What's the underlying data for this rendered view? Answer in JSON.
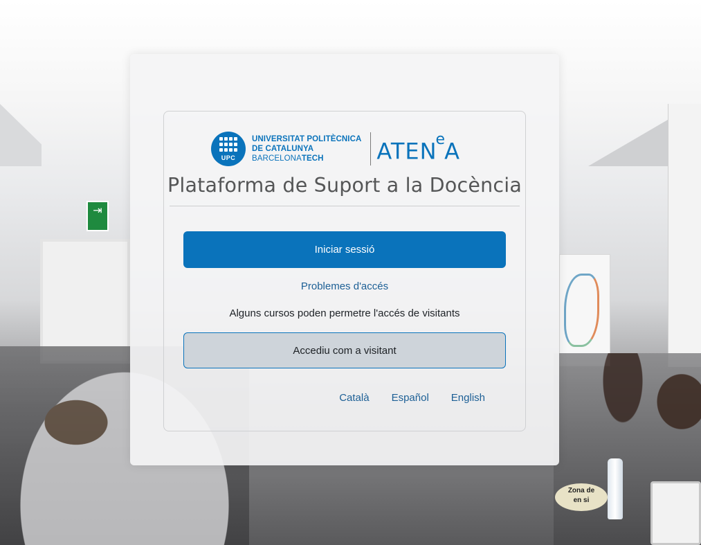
{
  "logo": {
    "upc_badge": "UPC",
    "university_line1": "UNIVERSITAT POLITÈCNICA",
    "university_line2": "DE CATALUNYA",
    "university_line3_light": "BARCELONA",
    "university_line3_bold": "TECH",
    "atenea_prefix": "ATEN",
    "atenea_sup": "e",
    "atenea_suffix": "A",
    "brand_color": "#0a73bb"
  },
  "title": "Plataforma de Suport a la Docència",
  "login": {
    "login_button": "Iniciar sessió",
    "problems_link": "Problemes d'accés",
    "guest_note": "Alguns cursos poden permetre l'accés de visitants",
    "guest_button": "Accediu com a visitant"
  },
  "languages": [
    "Català",
    "Español",
    "English"
  ],
  "background": {
    "exit_sign_icon": "exit-figure-icon",
    "desk_sign_text": "Zona de\nen si"
  },
  "colors": {
    "primary_button": "#0a73bb",
    "secondary_button": "#ced4da",
    "link": "#1c5f95",
    "title_text": "#555657"
  }
}
